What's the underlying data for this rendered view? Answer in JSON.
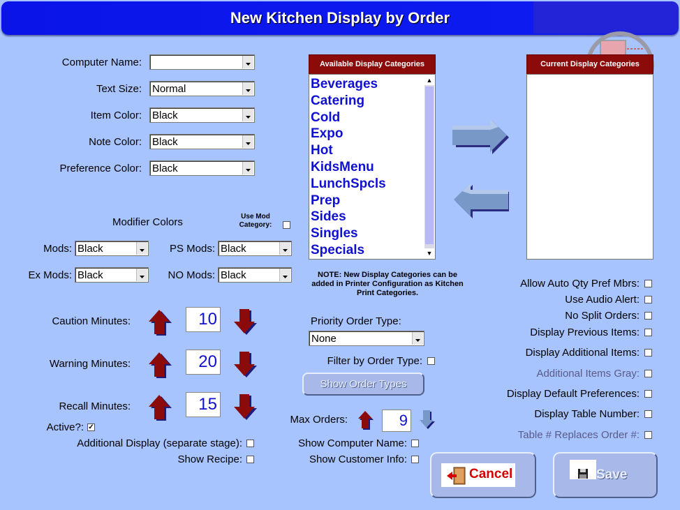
{
  "window": {
    "title": "New Kitchen Display by Order"
  },
  "fields": {
    "computer_name": {
      "label": "Computer Name:",
      "value": ""
    },
    "text_size": {
      "label": "Text Size:",
      "value": "Normal"
    },
    "item_color": {
      "label": "Item Color:",
      "value": "Black"
    },
    "note_color": {
      "label": "Note Color:",
      "value": "Black"
    },
    "preference_color": {
      "label": "Preference Color:",
      "value": "Black"
    }
  },
  "modifier_colors": {
    "heading": "Modifier Colors",
    "use_mod_category_line1": "Use Mod",
    "use_mod_category_line2": "Category:",
    "use_mod_category_checked": false,
    "mods": {
      "label": "Mods:",
      "value": "Black"
    },
    "ps_mods": {
      "label": "PS Mods:",
      "value": "Black"
    },
    "ex_mods": {
      "label": "Ex Mods:",
      "value": "Black"
    },
    "no_mods": {
      "label": "NO Mods:",
      "value": "Black"
    }
  },
  "minutes": {
    "caution": {
      "label": "Caution Minutes:",
      "value": "10"
    },
    "warning": {
      "label": "Warning Minutes:",
      "value": "20"
    },
    "recall": {
      "label": "Recall Minutes:",
      "value": "15"
    }
  },
  "left_checks": {
    "active": {
      "label": "Active?:",
      "checked": true,
      "mark": "✓"
    },
    "additional_display": {
      "label": "Additional Display (separate stage):",
      "checked": false
    },
    "show_recipe": {
      "label": "Show Recipe:",
      "checked": false
    }
  },
  "available_categories": {
    "header": "Available Display Categories",
    "items": [
      "Beverages",
      "Catering",
      "Cold",
      "Expo",
      "Hot",
      "KidsMenu",
      "LunchSpcls",
      "Prep",
      "Sides",
      "Singles",
      "Specials"
    ]
  },
  "current_categories": {
    "header": "Current Display Categories",
    "items": []
  },
  "note": "NOTE: New Display Categories can be added in Printer Configuration as Kitchen Print Categories.",
  "priority": {
    "label": "Priority Order Type:",
    "value": "None"
  },
  "filter_by_order_type": {
    "label": "Filter by Order Type:",
    "checked": false
  },
  "show_order_types_button": "Show Order Types",
  "max_orders": {
    "label": "Max Orders:",
    "value": "9"
  },
  "middle_checks": {
    "show_computer_name": {
      "label": "Show Computer Name:",
      "checked": false
    },
    "show_customer_info": {
      "label": "Show Customer Info:",
      "checked": false
    }
  },
  "right_checks": [
    {
      "label": "Allow Auto Qty Pref Mbrs:",
      "checked": false,
      "gray": false
    },
    {
      "label": "Use Audio Alert:",
      "checked": false,
      "gray": false
    },
    {
      "label": "No Split Orders:",
      "checked": false,
      "gray": false
    },
    {
      "label": "Display Previous Items:",
      "checked": false,
      "gray": false
    },
    {
      "label": "Display Additional Items:",
      "checked": false,
      "gray": false
    },
    {
      "label": "Additional Items Gray:",
      "checked": false,
      "gray": true
    },
    {
      "label": "Display Default Preferences:",
      "checked": false,
      "gray": false
    },
    {
      "label": "Display Table Number:",
      "checked": false,
      "gray": false
    },
    {
      "label": "Table # Replaces Order #:",
      "checked": false,
      "gray": true
    }
  ],
  "buttons": {
    "cancel": "Cancel",
    "save": "Save"
  },
  "colors": {
    "background": "#a8c4ff",
    "title_bar": "#0d1bf0",
    "list_header": "#8b0a0a",
    "category_text": "#1010d0",
    "arrow_red": "#8b0a0a",
    "cancel_text": "#d40000"
  }
}
